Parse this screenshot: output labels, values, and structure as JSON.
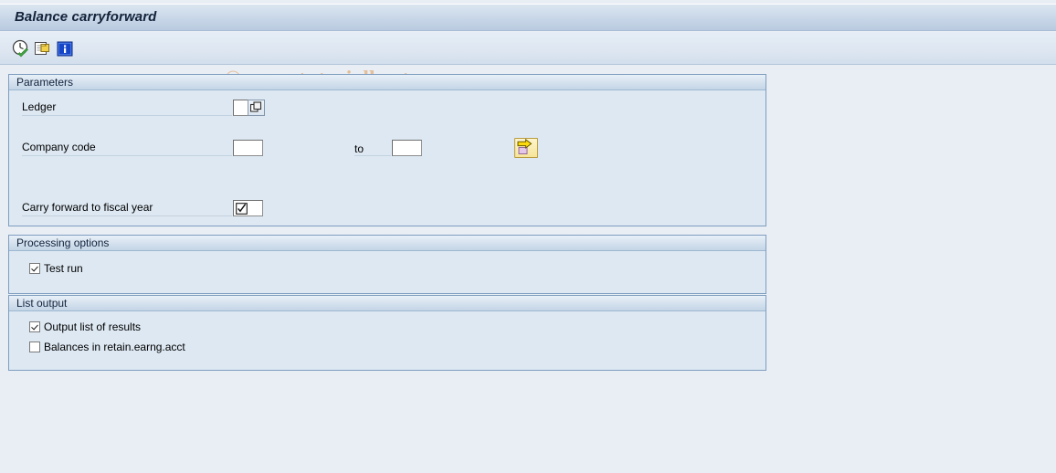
{
  "window": {
    "title": "Balance carryforward"
  },
  "watermark": {
    "text": "© www.tutorialkart.com"
  },
  "toolbar": {
    "buttons": [
      {
        "name": "execute-icon",
        "tooltip": "Execute"
      },
      {
        "name": "copy-icon",
        "tooltip": "Get Variant"
      },
      {
        "name": "info-icon",
        "tooltip": "Information"
      }
    ]
  },
  "panels": {
    "parameters": {
      "title": "Parameters",
      "fields": {
        "ledger": {
          "label": "Ledger",
          "value": "",
          "placeholder": ""
        },
        "company_code": {
          "label": "Company code",
          "value_from": "",
          "to_label": "to",
          "value_to": "",
          "multi_select_label": ""
        },
        "carry_forward": {
          "label": "Carry forward to fiscal year",
          "value": "",
          "checked": true
        }
      }
    },
    "processing_options": {
      "title": "Processing options",
      "checkboxes": [
        {
          "label": "Test run",
          "checked": true
        }
      ]
    },
    "list_output": {
      "title": "List output",
      "checkboxes": [
        {
          "label": "Output list of results",
          "checked": true
        },
        {
          "label": "Balances in retain.earng.acct",
          "checked": false
        }
      ]
    }
  },
  "colors": {
    "title_bar": "#cbd9e9",
    "panel_bg": "#dde8f2",
    "panel_border": "#7e9dbf",
    "page_bg": "#e9eef5",
    "watermark": "#e2b07e",
    "multi_button": "#f6e59a"
  }
}
